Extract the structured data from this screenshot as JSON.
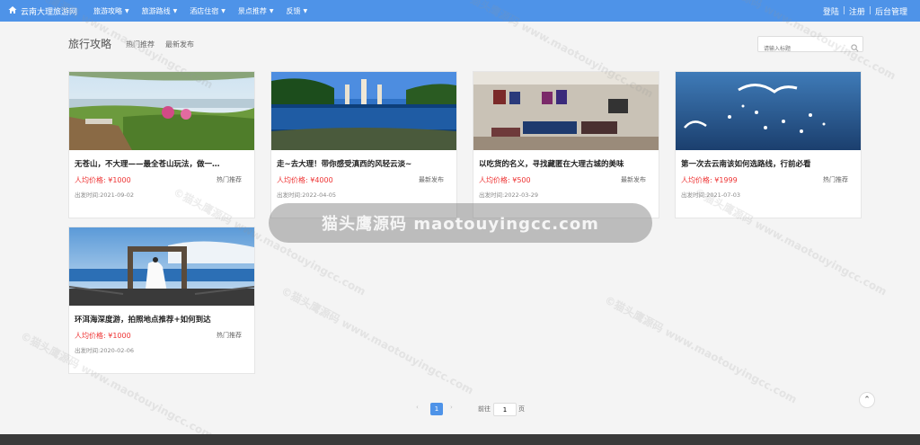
{
  "nav": {
    "brand": "云南大理旅游网",
    "menu": [
      {
        "label": "旅游攻略"
      },
      {
        "label": "旅游路线"
      },
      {
        "label": "酒店住宿"
      },
      {
        "label": "景点推荐"
      },
      {
        "label": "反馈"
      }
    ],
    "login": "登陆",
    "register": "注册",
    "admin": "后台管理"
  },
  "page": {
    "title": "旅行攻略",
    "tabs": [
      "热门推荐",
      "最新发布"
    ],
    "search_placeholder": "请输入标题"
  },
  "cards": [
    {
      "title": "无苍山，不大理——最全苍山玩法，做一…",
      "price": "人均价格: ¥1000",
      "tag": "热门推荐",
      "date": "出发时间:2021-09-02",
      "image": "tea-terrace-lake"
    },
    {
      "title": "走~去大理！带你感受滇西的风轻云淡~",
      "price": "人均价格: ¥4000",
      "tag": "最新发布",
      "date": "出发时间:2022-04-05",
      "image": "pagoda-lake-reflection"
    },
    {
      "title": "以吃货的名义，寻找藏匿在大理古城的美味",
      "price": "人均价格: ¥500",
      "tag": "最新发布",
      "date": "出发时间:2022-03-29",
      "image": "restaurant-interior"
    },
    {
      "title": "第一次去云南该如何选路线，行前必看",
      "price": "人均价格: ¥1999",
      "tag": "热门推荐",
      "date": "出发时间:2021-07-03",
      "image": "seagulls-over-lake"
    },
    {
      "title": "环洱海深度游，拍照地点推荐+如何到达",
      "price": "人均价格: ¥1000",
      "tag": "热门推荐",
      "date": "出发时间:2020-02-06",
      "image": "bride-photo-frame-pier"
    }
  ],
  "watermark": {
    "banner": "猫头鹰源码 maotouyingcc.com",
    "repeat": "©猫头鹰源码 www.maotouyingcc.com"
  },
  "pager": {
    "prev": "‹",
    "current": "1",
    "next": "›",
    "goto": "前往",
    "value": "1",
    "unit": "页"
  },
  "colors": {
    "nav_bg": "#4e93e8",
    "price": "#ee3333",
    "accent": "#4e93e8"
  }
}
